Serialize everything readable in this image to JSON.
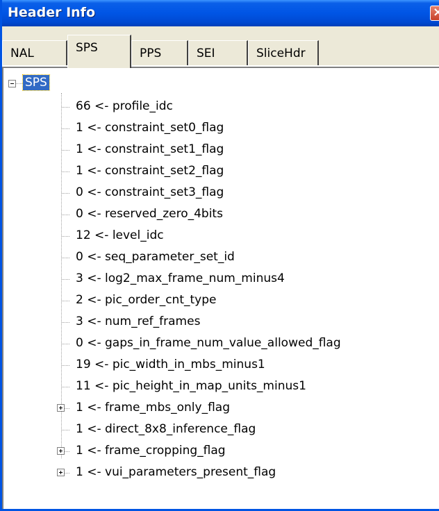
{
  "window": {
    "title": "Header Info",
    "close_glyph": "×"
  },
  "tabs": [
    {
      "label": "NAL",
      "active": false
    },
    {
      "label": "SPS",
      "active": true
    },
    {
      "label": "PPS",
      "active": false
    },
    {
      "label": "SEI",
      "active": false
    },
    {
      "label": "SliceHdr",
      "active": false
    }
  ],
  "tree": {
    "root_label": "SPS",
    "root_expanded": true,
    "items": [
      {
        "label": "66 <- profile_idc",
        "expandable": false
      },
      {
        "label": "1 <- constraint_set0_flag",
        "expandable": false
      },
      {
        "label": "1 <- constraint_set1_flag",
        "expandable": false
      },
      {
        "label": "1 <- constraint_set2_flag",
        "expandable": false
      },
      {
        "label": "0 <- constraint_set3_flag",
        "expandable": false
      },
      {
        "label": "0 <- reserved_zero_4bits",
        "expandable": false
      },
      {
        "label": "12 <- level_idc",
        "expandable": false
      },
      {
        "label": "0 <- seq_parameter_set_id",
        "expandable": false
      },
      {
        "label": "3 <- log2_max_frame_num_minus4",
        "expandable": false
      },
      {
        "label": "2 <- pic_order_cnt_type",
        "expandable": false
      },
      {
        "label": "3 <- num_ref_frames",
        "expandable": false
      },
      {
        "label": "0 <- gaps_in_frame_num_value_allowed_flag",
        "expandable": false
      },
      {
        "label": "19 <- pic_width_in_mbs_minus1",
        "expandable": false
      },
      {
        "label": "11 <- pic_height_in_map_units_minus1",
        "expandable": false
      },
      {
        "label": "1 <- frame_mbs_only_flag",
        "expandable": true
      },
      {
        "label": "1 <- direct_8x8_inference_flag",
        "expandable": false
      },
      {
        "label": "1 <- frame_cropping_flag",
        "expandable": true
      },
      {
        "label": "1 <- vui_parameters_present_flag",
        "expandable": true
      }
    ]
  },
  "colors": {
    "titlebar": "#0055e5",
    "selection": "#316ac5",
    "close_button": "#c6402b"
  }
}
